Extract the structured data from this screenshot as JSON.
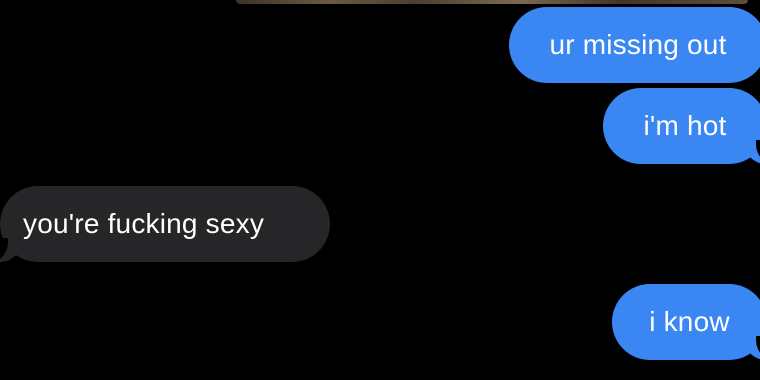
{
  "thread": {
    "messages": [
      {
        "direction": "sent",
        "text": "ur missing out"
      },
      {
        "direction": "sent",
        "text": "i'm hot"
      },
      {
        "direction": "received",
        "text": "you're fucking sexy"
      },
      {
        "direction": "sent",
        "text": "i know"
      }
    ]
  },
  "colors": {
    "background": "#000000",
    "sent_bubble": "#3a87f4",
    "received_bubble": "#262628",
    "text": "#ffffff"
  }
}
